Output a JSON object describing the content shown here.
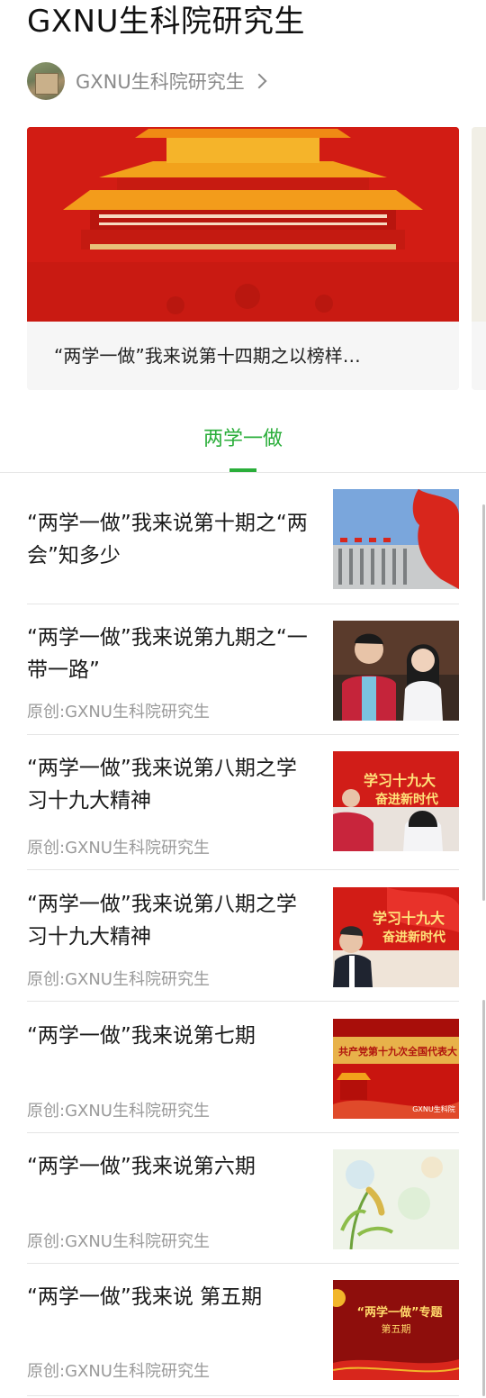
{
  "header": {
    "title": "GXNU生科院研究生"
  },
  "account": {
    "name": "GXNU生科院研究生",
    "chevron_icon": "chevron-right-icon"
  },
  "carousel": {
    "caption": "“两学一做”我来说第十四期之以榜样…"
  },
  "tab": {
    "label": "两学一做",
    "accent": "#2aae3a"
  },
  "articles": [
    {
      "title": "“两学一做”我来说第十期之“两会”知多少",
      "source": ""
    },
    {
      "title": "“两学一做”我来说第九期之“一带一路”",
      "source": "原创:GXNU生科院研究生"
    },
    {
      "title": "“两学一做”我来说第八期之学习十九大精神",
      "source": "原创:GXNU生科院研究生"
    },
    {
      "title": "“两学一做”我来说第八期之学习十九大精神",
      "source": "原创:GXNU生科院研究生"
    },
    {
      "title": "“两学一做”我来说第七期",
      "source": "原创:GXNU生科院研究生"
    },
    {
      "title": "“两学一做”我来说第六期",
      "source": "原创:GXNU生科院研究生"
    },
    {
      "title": "“两学一做”我来说 第五期",
      "source": "原创:GXNU生科院研究生"
    }
  ],
  "thumb_text": {
    "study_banner_1": "学习十九大",
    "study_banner_2": "奋进新时代",
    "congress_banner": "共产党第十九次全国代表大",
    "watermark": "GXNU生科院",
    "special_topic": "“两学一做”专题",
    "issue_five": "第五期"
  }
}
